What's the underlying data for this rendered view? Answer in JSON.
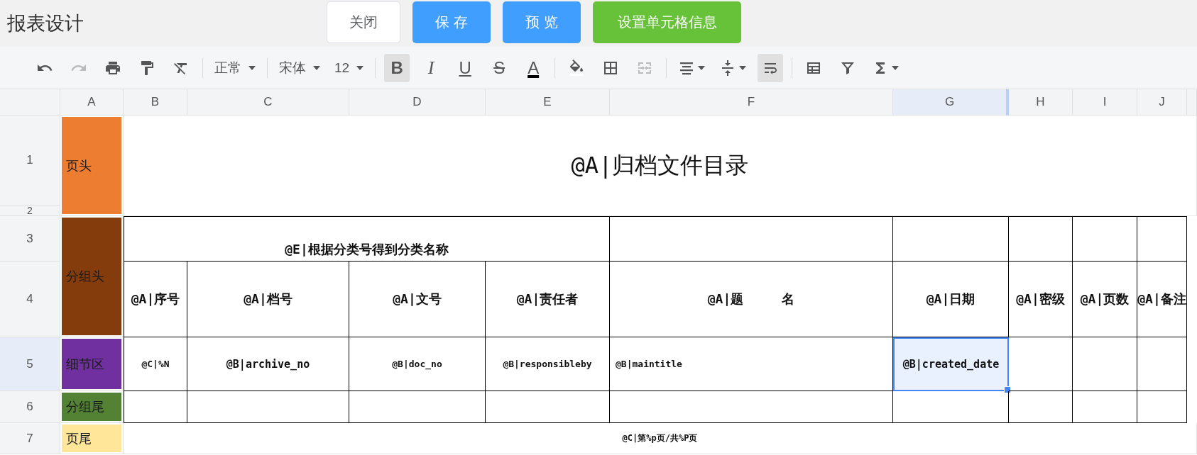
{
  "window": {
    "title": "报表设计"
  },
  "buttons": [
    {
      "label": "关闭",
      "kind": "default"
    },
    {
      "label": "保 存",
      "kind": "primary"
    },
    {
      "label": "预 览",
      "kind": "primary"
    },
    {
      "label": "设置单元格信息",
      "kind": "success"
    }
  ],
  "toolbar": [
    {
      "kind": "icon",
      "disabled": false
    },
    {
      "kind": "icon",
      "disabled": true
    },
    {
      "kind": "icon",
      "disabled": false
    },
    {
      "kind": "icon",
      "disabled": false
    },
    {
      "kind": "icon",
      "disabled": false
    },
    {
      "kind": "separator"
    },
    {
      "kind": "dropdown",
      "label": "正常"
    },
    {
      "kind": "separator"
    },
    {
      "kind": "dropdown",
      "label": "宋体"
    },
    {
      "kind": "dropdown",
      "label": "12"
    },
    {
      "kind": "separator"
    },
    {
      "kind": "glyph",
      "label": "B",
      "selected": true
    },
    {
      "kind": "glyph",
      "label": "I",
      "selected": false
    },
    {
      "kind": "glyph",
      "label": "U",
      "selected": false
    },
    {
      "kind": "glyph",
      "label": "S",
      "selected": false
    },
    {
      "kind": "glyph",
      "label": "A",
      "selected": false
    },
    {
      "kind": "separator"
    },
    {
      "kind": "icon",
      "disabled": false
    },
    {
      "kind": "icon",
      "disabled": false
    },
    {
      "kind": "icon",
      "disabled": true
    },
    {
      "kind": "separator"
    },
    {
      "kind": "menu",
      "disabled": false
    },
    {
      "kind": "menu",
      "disabled": false
    },
    {
      "kind": "icon",
      "disabled": false,
      "selected": true
    },
    {
      "kind": "separator"
    },
    {
      "kind": "icon",
      "disabled": false
    },
    {
      "kind": "icon",
      "disabled": false
    },
    {
      "kind": "menu",
      "disabled": false
    }
  ],
  "sheet": {
    "columns": [
      {
        "label": "A",
        "selected": false
      },
      {
        "label": "B",
        "selected": false
      },
      {
        "label": "C",
        "selected": false
      },
      {
        "label": "D",
        "selected": false
      },
      {
        "label": "E",
        "selected": false
      },
      {
        "label": "F",
        "selected": false
      },
      {
        "label": "G",
        "selected": true
      },
      {
        "label": "H",
        "selected": false
      },
      {
        "label": "I",
        "selected": false
      },
      {
        "label": "J",
        "selected": false
      }
    ],
    "rows": [
      {
        "label": "1",
        "selected": false
      },
      {
        "label": "2",
        "selected": false
      },
      {
        "label": "3",
        "selected": false
      },
      {
        "label": "4",
        "selected": false
      },
      {
        "label": "5",
        "selected": true
      },
      {
        "label": "6",
        "selected": false
      },
      {
        "label": "7",
        "selected": false
      }
    ],
    "bands": [
      {
        "label": "页头",
        "color": "#ed7d31"
      },
      {
        "label": "分组头",
        "color": "#843c0c"
      },
      {
        "label": "细节区",
        "color": "#7030a0"
      },
      {
        "label": "分组尾",
        "color": "#548235"
      },
      {
        "label": "页尾",
        "color": "#ffe699"
      }
    ],
    "title": "@A|归档文件目录",
    "group_title": "@E|根据分类号得到分类名称",
    "header_cells": [
      "@A|序号",
      "@A|档号",
      "@A|文号",
      "@A|责任者",
      "@A|题　　　名",
      "@A|日期",
      "@A|密级",
      "@A|页数",
      "@A|备注"
    ],
    "detail_cells": [
      {
        "text": "@C|%N",
        "selected": false
      },
      {
        "text": "@B|archive_no",
        "selected": false
      },
      {
        "text": "@B|doc_no",
        "selected": false
      },
      {
        "text": "@B|responsibleby",
        "selected": false
      },
      {
        "text": "@B|maintitle",
        "selected": false
      },
      {
        "text": "@B|created_date",
        "selected": true
      }
    ],
    "footer": "@C|第%p页/共%P页"
  }
}
